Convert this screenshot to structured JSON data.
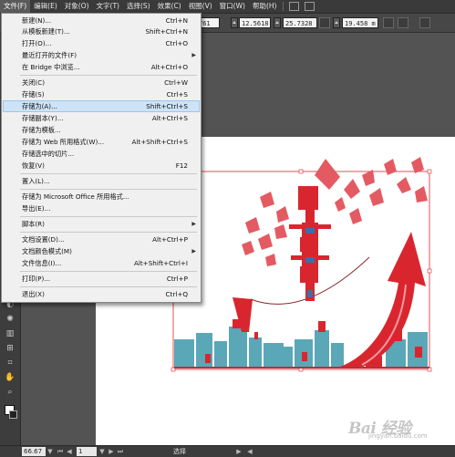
{
  "menubar": {
    "items": [
      "文件(F)",
      "编辑(E)",
      "对象(O)",
      "文字(T)",
      "选择(S)",
      "效果(C)",
      "视图(V)",
      "窗口(W)",
      "帮助(H)"
    ]
  },
  "controlbar": {
    "fields": [
      "761",
      "12.5618",
      "25.7328",
      "19.458 m"
    ]
  },
  "file_menu": {
    "items": [
      {
        "label": "新建(N)...",
        "shortcut": "Ctrl+N"
      },
      {
        "label": "从模板新建(T)...",
        "shortcut": "Shift+Ctrl+N"
      },
      {
        "label": "打开(O)...",
        "shortcut": "Ctrl+O"
      },
      {
        "label": "最近打开的文件(F)",
        "shortcut": ""
      },
      {
        "label": "在 Bridge 中浏览...",
        "shortcut": "Alt+Ctrl+O"
      },
      {
        "label": "关闭(C)",
        "shortcut": "Ctrl+W"
      },
      {
        "label": "存储(S)",
        "shortcut": "Ctrl+S"
      },
      {
        "label": "存储为(A)...",
        "shortcut": "Shift+Ctrl+S"
      },
      {
        "label": "存储副本(Y)...",
        "shortcut": "Alt+Ctrl+S"
      },
      {
        "label": "存储为模板...",
        "shortcut": ""
      },
      {
        "label": "存储为 Web 所用格式(W)...",
        "shortcut": "Alt+Shift+Ctrl+S"
      },
      {
        "label": "存储选中的切片...",
        "shortcut": ""
      },
      {
        "label": "恢复(V)",
        "shortcut": "F12"
      },
      {
        "label": "置入(L)...",
        "shortcut": ""
      },
      {
        "label": "存储为 Microsoft Office 所用格式...",
        "shortcut": ""
      },
      {
        "label": "导出(E)...",
        "shortcut": ""
      },
      {
        "label": "脚本(R)",
        "shortcut": ""
      },
      {
        "label": "文档设置(D)...",
        "shortcut": "Alt+Ctrl+P"
      },
      {
        "label": "文档颜色模式(M)",
        "shortcut": ""
      },
      {
        "label": "文件信息(I)...",
        "shortcut": "Alt+Shift+Ctrl+I"
      },
      {
        "label": "打印(P)...",
        "shortcut": "Ctrl+P"
      },
      {
        "label": "退出(X)",
        "shortcut": "Ctrl+Q"
      }
    ]
  },
  "statusbar": {
    "zoom": "66.67",
    "page": "1",
    "tool_status": "选择"
  },
  "watermark": {
    "text": "Bai 经验",
    "url": "jingyan.baidu.com"
  },
  "colors": {
    "artwork_red": "#d9262e",
    "artwork_teal": "#5aa7b8",
    "menu_highlight": "#cde3f7"
  }
}
